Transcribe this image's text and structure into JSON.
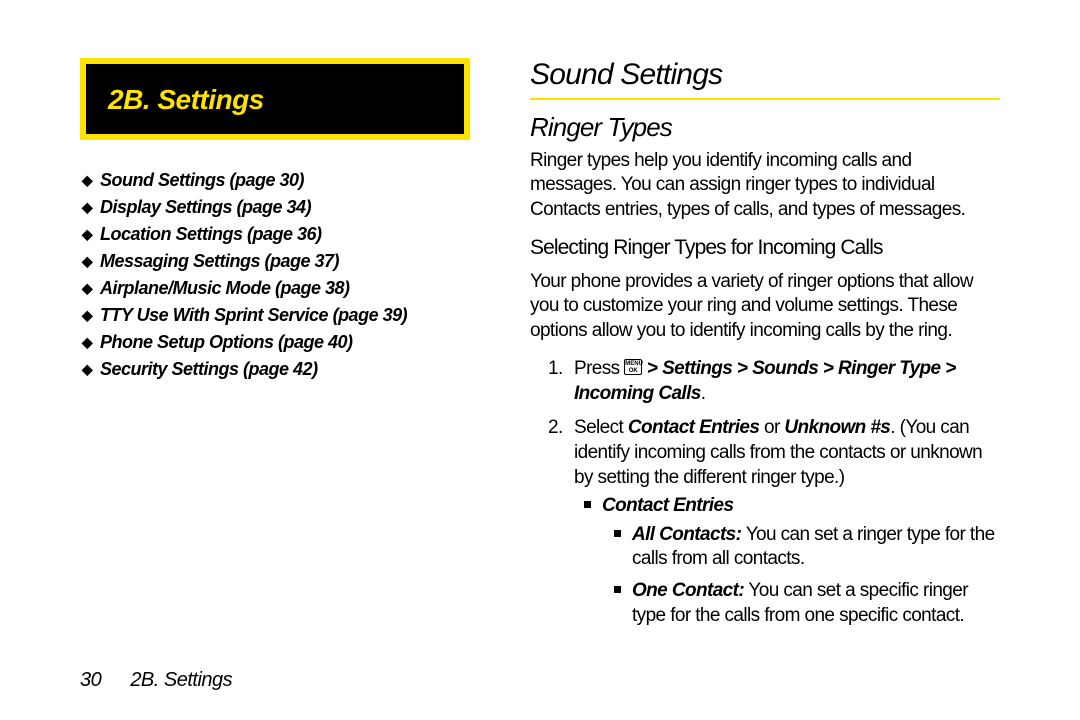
{
  "badge": {
    "title": "2B.  Settings"
  },
  "toc": [
    "Sound Settings (page 30)",
    "Display Settings (page 34)",
    "Location Settings (page 36)",
    "Messaging Settings (page 37)",
    "Airplane/Music Mode (page 38)",
    "TTY Use With Sprint Service (page 39)",
    "Phone Setup Options (page 40)",
    "Security Settings (page 42)"
  ],
  "right": {
    "h2": "Sound Settings",
    "h3": "Ringer Types",
    "intro": "Ringer types help you identify incoming calls and messages. You can assign ringer types to individual Contacts entries, types of calls, and types of messages.",
    "h4": "Selecting Ringer Types for Incoming Calls",
    "p2": "Your phone provides a variety of ringer options that allow you to customize your ring and volume settings. These options allow you to identify incoming calls by the ring.",
    "step1_pre": "Press ",
    "step1_path": " > Settings > Sounds > Ringer Type > Incoming Calls",
    "step1_post": ".",
    "step2_a": "Select ",
    "step2_b1": "Contact Entries",
    "step2_mid": " or ",
    "step2_b2": "Unknown #s",
    "step2_c": ". (You can identify incoming calls from the contacts or unknown by setting the different ringer type.)",
    "ce_head": "Contact Entries",
    "ce_all_b": "All Contacts:",
    "ce_all_t": "  You can set a ringer type for the calls  from all contacts.",
    "ce_one_b": "One Contact:",
    "ce_one_t": "  You can set a specific ringer type for the calls from one specific contact."
  },
  "footer": {
    "page": "30",
    "section": "2B. Settings"
  }
}
